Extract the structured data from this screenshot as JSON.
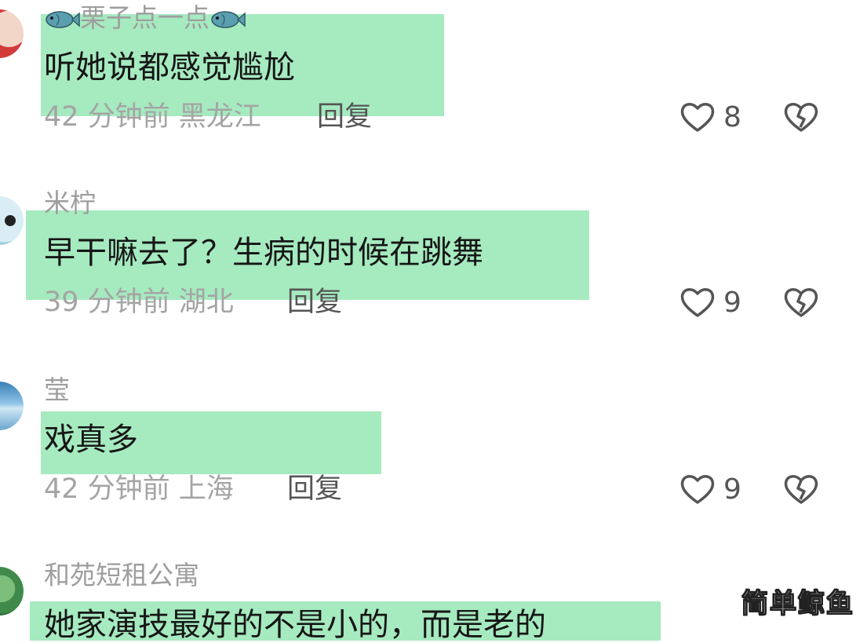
{
  "comments": [
    {
      "username": "栗子点一点",
      "text": "听她说都感觉尴尬",
      "meta": "42 分钟前  黑龙江",
      "reply_label": "回复",
      "likes": "8"
    },
    {
      "username": "米柠",
      "text": "早干嘛去了？生病的时候在跳舞",
      "meta": "39 分钟前  湖北",
      "reply_label": "回复",
      "likes": "9"
    },
    {
      "username": "莹",
      "text": "戏真多",
      "meta": "42 分钟前  上海",
      "reply_label": "回复",
      "likes": "9"
    },
    {
      "username": "和苑短租公寓",
      "text": "她家演技最好的不是小的，而是老的"
    }
  ],
  "watermark": "简单鲸鱼",
  "colors": {
    "highlight": "#a6eac0",
    "muted_text": "#a4a4a4",
    "icon_stroke": "#555555"
  },
  "icons": {
    "username_decoration": "fish-icon",
    "like": "heart-icon",
    "dislike": "broken-heart-icon"
  }
}
